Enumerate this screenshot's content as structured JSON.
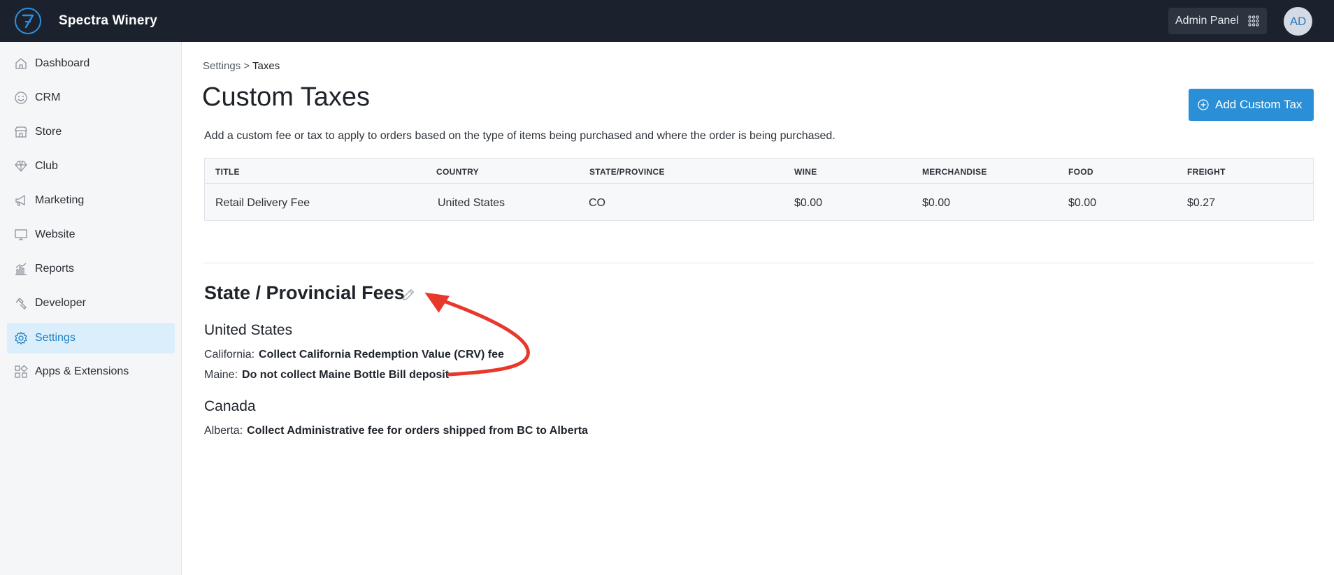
{
  "app": {
    "brand": "Spectra Winery",
    "admin_panel_label": "Admin Panel",
    "avatar_initials": "AD"
  },
  "sidebar": {
    "items": [
      {
        "label": "Dashboard",
        "icon": "home-icon"
      },
      {
        "label": "CRM",
        "icon": "smiley-icon"
      },
      {
        "label": "Store",
        "icon": "storefront-icon"
      },
      {
        "label": "Club",
        "icon": "diamond-icon"
      },
      {
        "label": "Marketing",
        "icon": "megaphone-icon"
      },
      {
        "label": "Website",
        "icon": "monitor-icon"
      },
      {
        "label": "Reports",
        "icon": "bar-chart-icon"
      },
      {
        "label": "Developer",
        "icon": "hammer-icon"
      },
      {
        "label": "Settings",
        "icon": "gear-icon",
        "active": true
      },
      {
        "label": "Apps & Extensions",
        "icon": "apps-icon"
      }
    ]
  },
  "breadcrumb": {
    "parent": "Settings",
    "separator": ">",
    "current": "Taxes"
  },
  "page": {
    "title": "Custom Taxes",
    "add_button_label": "Add Custom Tax",
    "description": "Add a custom fee or tax to apply to orders based on the type of items being purchased and where the order is being purchased."
  },
  "table": {
    "headers": [
      "TITLE",
      "COUNTRY",
      "STATE/PROVINCE",
      "WINE",
      "MERCHANDISE",
      "FOOD",
      "FREIGHT"
    ],
    "rows": [
      [
        "Retail Delivery Fee",
        "United States",
        "CO",
        "$0.00",
        "$0.00",
        "$0.00",
        "$0.27"
      ]
    ]
  },
  "fees": {
    "title": "State / Provincial Fees",
    "groups": [
      {
        "country": "United States",
        "lines": [
          {
            "region": "California:",
            "value": "Collect California Redemption Value (CRV) fee"
          },
          {
            "region": "Maine:",
            "value": "Do not collect Maine Bottle Bill deposit"
          }
        ]
      },
      {
        "country": "Canada",
        "lines": [
          {
            "region": "Alberta:",
            "value": "Collect Administrative fee for orders shipped from BC to Alberta"
          }
        ]
      }
    ]
  },
  "colors": {
    "topbar": "#1b222d",
    "accent": "#2a8fd6",
    "active_nav_bg": "#dbeefb",
    "annotation_arrow": "#e8382b"
  }
}
